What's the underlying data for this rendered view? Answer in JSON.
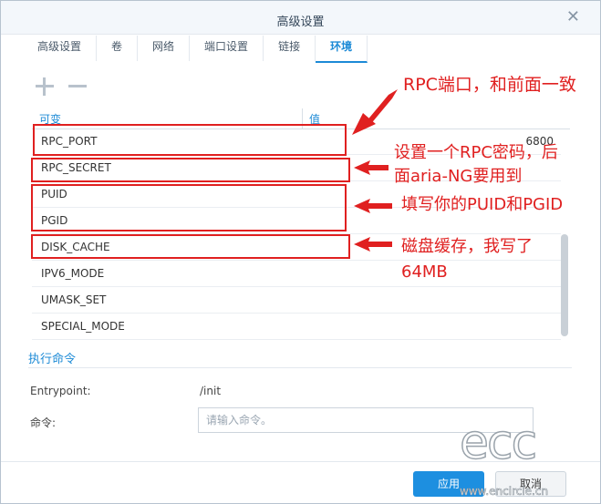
{
  "window": {
    "title": "高级设置",
    "close_icon": "close-icon"
  },
  "tabs": [
    {
      "label": "高级设置"
    },
    {
      "label": "卷"
    },
    {
      "label": "网络"
    },
    {
      "label": "端口设置"
    },
    {
      "label": "链接"
    },
    {
      "label": "环境",
      "active": true
    }
  ],
  "toolbar": {
    "add_icon": "plus-icon",
    "remove_icon": "minus-icon"
  },
  "env_table": {
    "headers": {
      "key": "可变",
      "value": "值"
    },
    "rows": [
      {
        "key": "RPC_PORT",
        "value": "6800"
      },
      {
        "key": "RPC_SECRET",
        "value": ""
      },
      {
        "key": "PUID",
        "value": ""
      },
      {
        "key": "PGID",
        "value": ""
      },
      {
        "key": "DISK_CACHE",
        "value": ""
      },
      {
        "key": "IPV6_MODE",
        "value": ""
      },
      {
        "key": "UMASK_SET",
        "value": ""
      },
      {
        "key": "SPECIAL_MODE",
        "value": ""
      }
    ]
  },
  "execute": {
    "section_title": "执行命令",
    "entrypoint_label": "Entrypoint:",
    "entrypoint_value": "/init",
    "command_label": "命令:",
    "command_placeholder": "请输入命令。",
    "command_value": ""
  },
  "footer": {
    "apply_label": "应用",
    "cancel_label": "取消"
  },
  "annotations": {
    "color": "#e02020",
    "rpc_port_note": "RPC端口，和前面一致",
    "rpc_secret_note_line1": "设置一个RPC密码，后",
    "rpc_secret_note_line2": "面aria-NG要用到",
    "puid_pgid_note": "填写你的PUID和PGID",
    "disk_cache_note_line1": "磁盘缓存，我写了",
    "disk_cache_note_line2": "64MB"
  },
  "watermark": {
    "logo_text": "ecc",
    "url": "www.encircle.cn"
  }
}
